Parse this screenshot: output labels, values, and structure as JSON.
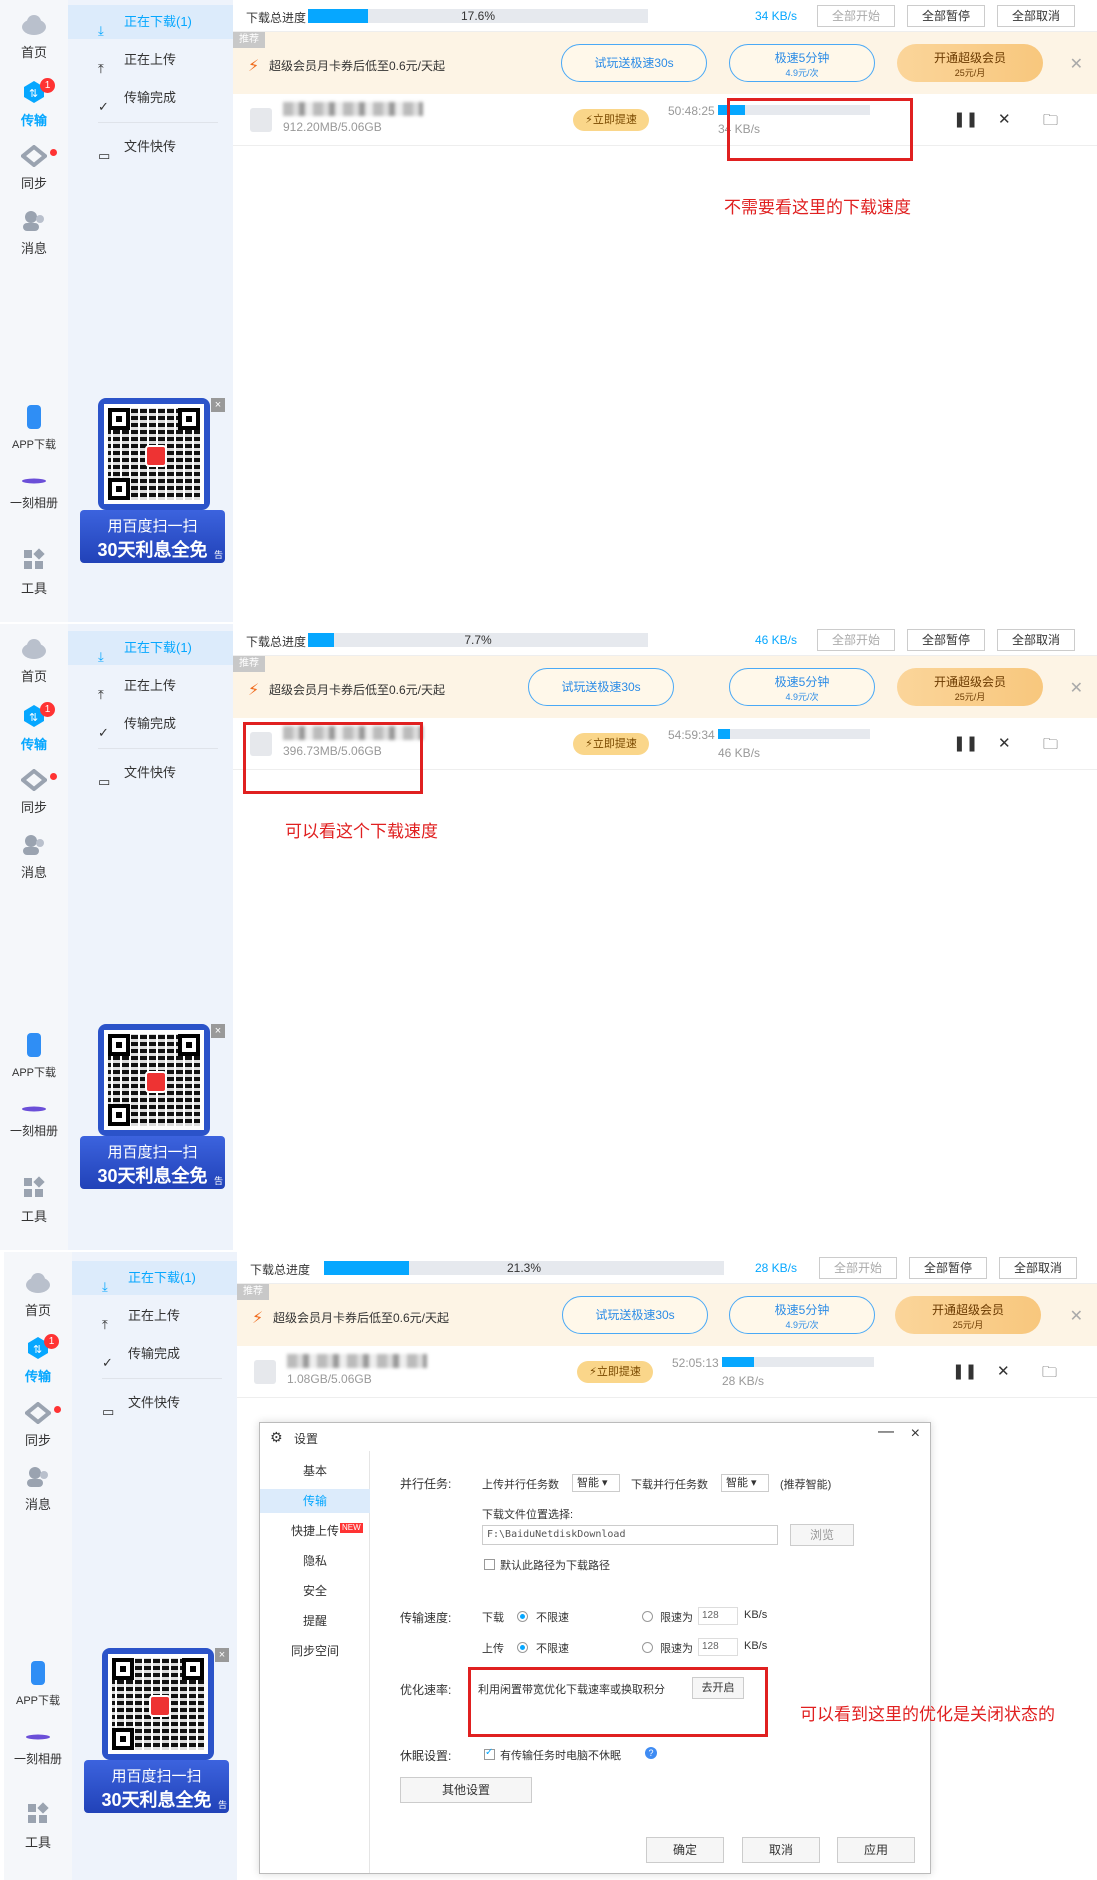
{
  "nav": {
    "home": "首页",
    "transfer": "传输",
    "transfer_badge": "1",
    "sync": "同步",
    "messages": "消息",
    "app_download": "APP下载",
    "album": "一刻相册",
    "tools": "工具"
  },
  "subnav": {
    "downloading": "正在下载(1)",
    "uploading": "正在上传",
    "completed": "传输完成",
    "quick_transfer": "文件快传"
  },
  "ad": {
    "line1": "用百度扫一扫",
    "line2": "30天利息全免",
    "tag": "告",
    "close": "×"
  },
  "toolbar": {
    "progress_label": "下载总进度",
    "start_all": "全部开始",
    "pause_all": "全部暂停",
    "cancel_all": "全部取消"
  },
  "promo": {
    "recommend": "推荐",
    "text": "超级会员月卡券后低至0.6元/天起",
    "trial": "试玩送极速30s",
    "speed_title": "极速5分钟",
    "speed_sub": "4.9元/次",
    "vip_title": "开通超级会员",
    "vip_sub": "25元/月"
  },
  "boost_label": "⚡立即提速",
  "panels": [
    {
      "total_progress": "17.6%",
      "total_progress_value": 0.176,
      "total_speed": "34 KB/s",
      "file_size": "912.20MB/5.06GB",
      "time_left": "50:48:25",
      "row_speed": "34 KB/s",
      "row_progress_value": 0.18,
      "note": "不需要看这里的下载速度"
    },
    {
      "total_progress": "7.7%",
      "total_progress_value": 0.077,
      "total_speed": "46 KB/s",
      "file_size": "396.73MB/5.06GB",
      "time_left": "54:59:34",
      "row_speed": "46 KB/s",
      "row_progress_value": 0.08,
      "note": "可以看这个下载速度"
    },
    {
      "total_progress": "21.3%",
      "total_progress_value": 0.213,
      "total_speed": "28 KB/s",
      "file_size": "1.08GB/5.06GB",
      "time_left": "52:05:13",
      "row_speed": "28 KB/s",
      "row_progress_value": 0.21,
      "note": "可以看到这里的优化是关闭状态的"
    }
  ],
  "settings": {
    "title": "设置",
    "minimize": "—",
    "close": "×",
    "tabs": [
      "基本",
      "传输",
      "快捷上传",
      "隐私",
      "安全",
      "提醒",
      "同步空间"
    ],
    "new_tag": "NEW",
    "parallel_label": "并行任务:",
    "upload_parallel": "上传并行任务数",
    "upload_parallel_value": "智能",
    "download_parallel": "下载并行任务数",
    "download_parallel_value": "智能",
    "recommend_hint": "(推荐智能)",
    "dl_location_label": "下载文件位置选择:",
    "dl_path": "F:\\BaiduNetdiskDownload",
    "browse": "浏览",
    "default_path": "默认此路径为下载路径",
    "speed_label": "传输速度:",
    "download": "下载",
    "upload": "上传",
    "unlimited": "不限速",
    "limit_to": "限速为",
    "limit_value": "128",
    "unit": "KB/s",
    "optimize_label": "优化速率:",
    "optimize_text": "利用闲置带宽优化下载速率或换取积分",
    "enable": "去开启",
    "sleep_label": "休眠设置:",
    "sleep_text": "有传输任务时电脑不休眠",
    "help": "?",
    "other": "其他设置",
    "ok": "确定",
    "cancel": "取消",
    "apply": "应用"
  },
  "colors": {
    "accent": "#06a7ff",
    "annotation": "#e02020"
  }
}
